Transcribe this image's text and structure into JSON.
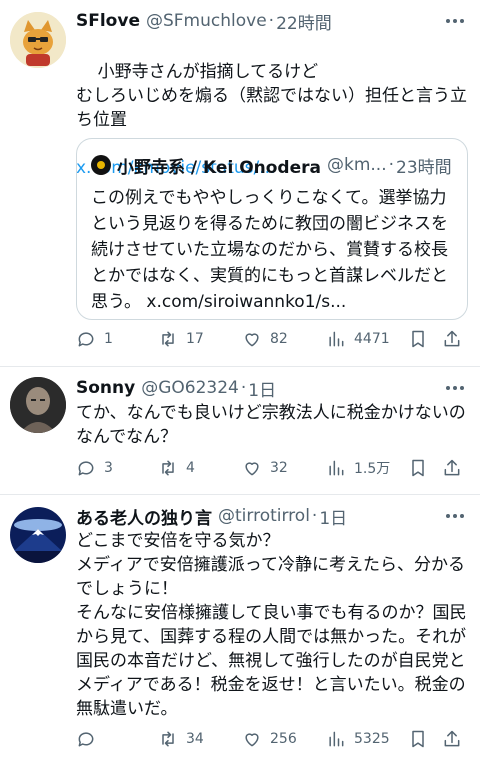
{
  "tweets": [
    {
      "name": "SFlove",
      "handle": "@SFmuchlove",
      "time": "22時間",
      "text": "小野寺さんが指摘してるけど\nむしろいじめを煽る（黙認ではない）担任と言う立ち位置",
      "link": "x.com/kmovie/status/...",
      "quote": {
        "name": "小野寺系 / Kei Onodera",
        "handle": "@km...",
        "time": "23時間",
        "text": "この例えでもややしっくりこなくて。選挙協力という見返りを得るために教団の闇ビジネスを続けさせていた立場なのだから、賞賛する校長とかではなく、実質的にもっと首謀レベルだと思う。 x.com/siroiwannko1/s..."
      },
      "actions": {
        "reply": "1",
        "retweet": "17",
        "like": "82",
        "views": "4471"
      }
    },
    {
      "name": "Sonny",
      "handle": "@GO62324",
      "time": "1日",
      "text": "てか、なんでも良いけど宗教法人に税金かけないのなんでなん？",
      "actions": {
        "reply": "3",
        "retweet": "4",
        "like": "32",
        "views": "1.5万"
      }
    },
    {
      "name": "ある老人の独り言",
      "handle": "@tirrotirrol",
      "time": "1日",
      "text": "どこまで安倍を守る気か？\nメディアで安倍擁護派って冷静に考えたら、分かるでしょうに！\nそんなに安倍様擁護して良い事でも有るのか？国民から見て、国葬する程の人間では無かった。それが国民の本音だけど、無視して強行したのが自民党とメディアである！税金を返せ！と言いたい。税金の無駄遣いだ。",
      "actions": {
        "reply": "",
        "retweet": "34",
        "like": "256",
        "views": "5325"
      }
    }
  ],
  "meta_sep": "·",
  "colors": {
    "link": "#1d9bf0",
    "secondary": "#536471",
    "divider": "#e6e9ec"
  }
}
